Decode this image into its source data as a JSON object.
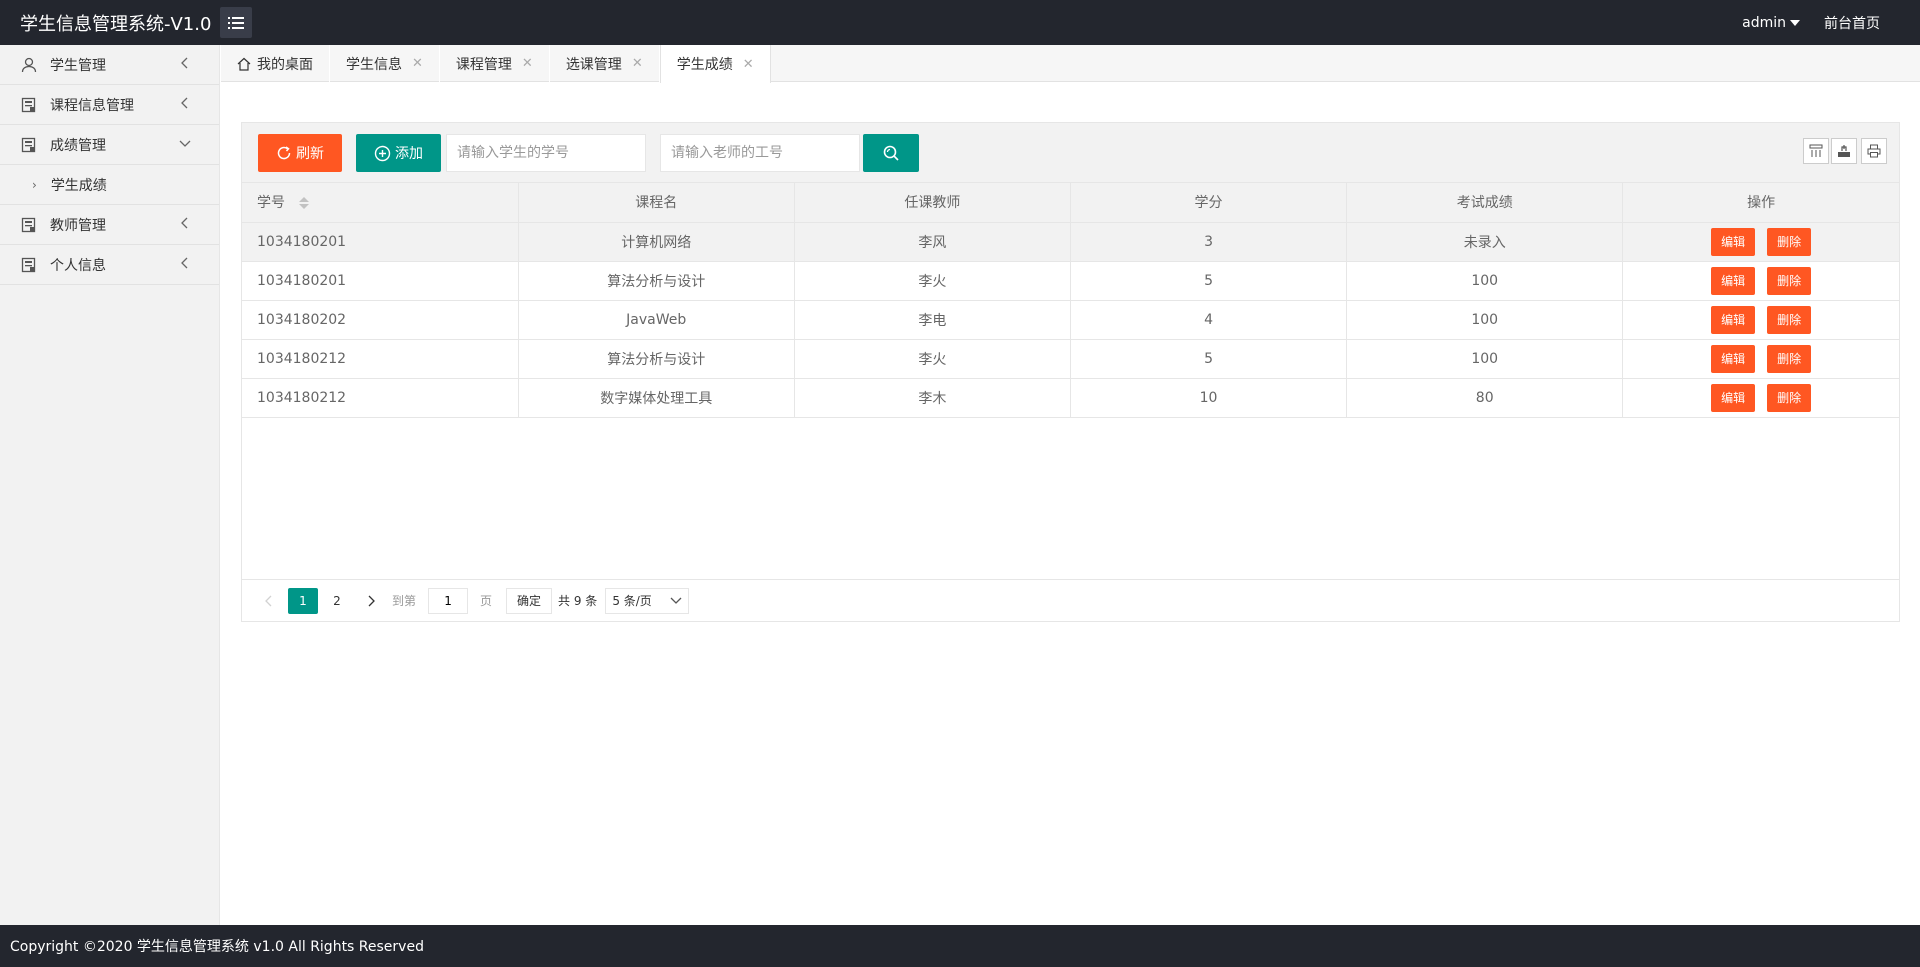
{
  "header": {
    "title": "学生信息管理系统-V1.0",
    "user": "admin",
    "front_link": "前台首页"
  },
  "sidebar": {
    "items": [
      {
        "label": "学生管理",
        "icon": "user-icon"
      },
      {
        "label": "课程信息管理",
        "icon": "list-icon"
      },
      {
        "label": "成绩管理",
        "icon": "list-icon",
        "expanded": true
      },
      {
        "label": "教师管理",
        "icon": "list-icon"
      },
      {
        "label": "个人信息",
        "icon": "list-icon"
      }
    ],
    "sub_items": [
      {
        "label": "学生成绩"
      }
    ]
  },
  "tabs": [
    {
      "label": "我的桌面",
      "closable": false
    },
    {
      "label": "学生信息",
      "closable": true
    },
    {
      "label": "课程管理",
      "closable": true
    },
    {
      "label": "选课管理",
      "closable": true
    },
    {
      "label": "学生成绩",
      "closable": true,
      "active": true
    }
  ],
  "toolbar": {
    "refresh_label": "刷新",
    "add_label": "添加",
    "student_placeholder": "请输入学生的学号",
    "teacher_placeholder": "请输入老师的工号"
  },
  "table": {
    "columns": [
      "学号",
      "课程名",
      "任课教师",
      "学分",
      "考试成绩",
      "操作"
    ],
    "rows": [
      [
        "1034180201",
        "计算机网络",
        "李风",
        "3",
        "未录入"
      ],
      [
        "1034180201",
        "算法分析与设计",
        "李火",
        "5",
        "100"
      ],
      [
        "1034180202",
        "JavaWeb",
        "李电",
        "4",
        "100"
      ],
      [
        "1034180212",
        "算法分析与设计",
        "李火",
        "5",
        "100"
      ],
      [
        "1034180212",
        "数字媒体处理工具",
        "李木",
        "10",
        "80"
      ]
    ],
    "edit_label": "编辑",
    "delete_label": "删除"
  },
  "pager": {
    "pages": [
      "1",
      "2"
    ],
    "current": "1",
    "goto_label": "到第",
    "goto_value": "1",
    "page_unit": "页",
    "confirm_label": "确定",
    "total_label": "共 9 条",
    "limit_label": "5 条/页"
  },
  "colors": {
    "header_bg": "#23262e",
    "accent_green": "#009688",
    "accent_orange": "#ff5722"
  },
  "footer": {
    "text": "Copyright ©2020 学生信息管理系统 v1.0 All Rights Reserved"
  }
}
